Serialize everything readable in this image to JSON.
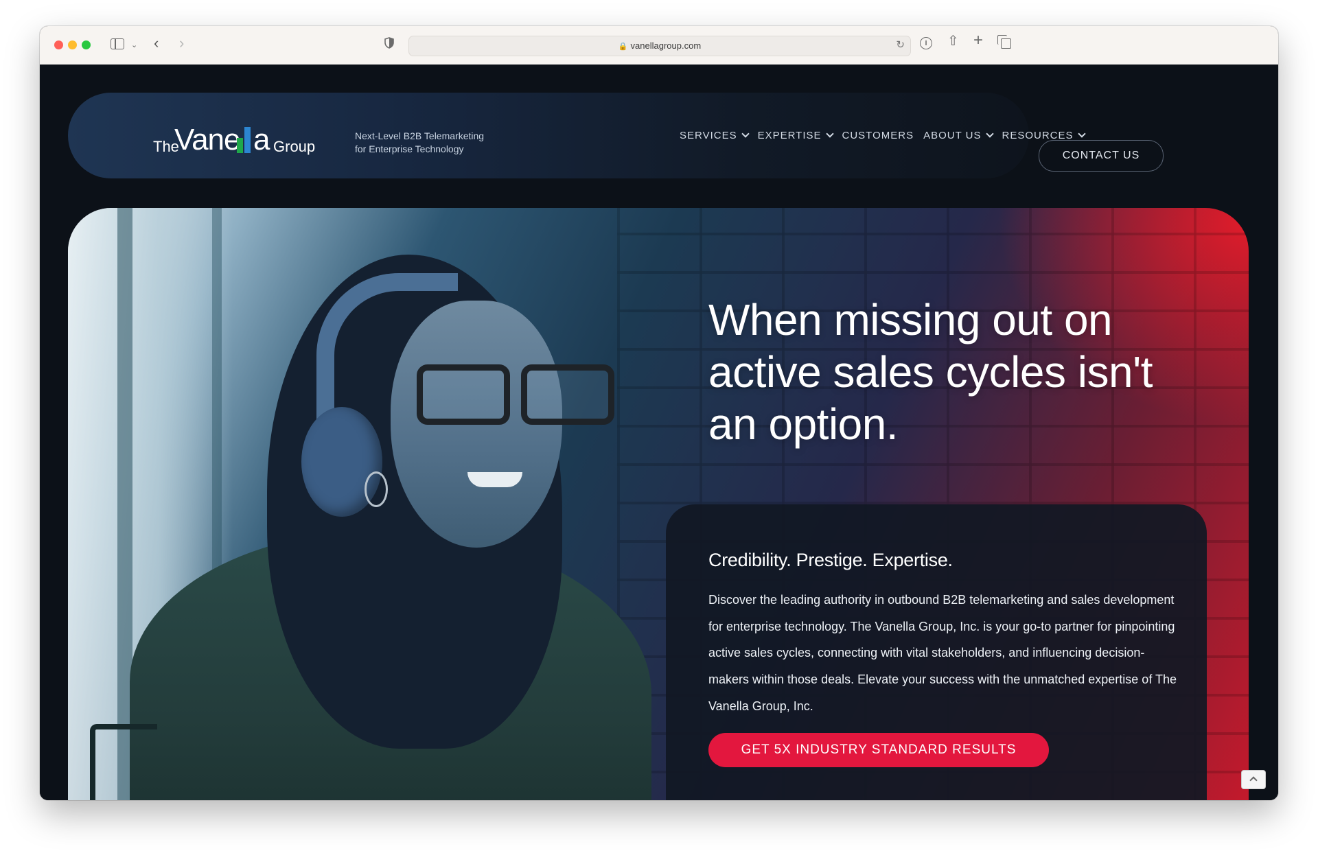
{
  "browser": {
    "url": "vanellagroup.com"
  },
  "logo": {
    "the": "The",
    "vane": "Vane",
    "a": "a",
    "group": "Group",
    "colors": {
      "green": "#1fa84a",
      "blue": "#2c86d1"
    }
  },
  "tagline": {
    "line1": "Next-Level B2B Telemarketing",
    "line2": "for Enterprise Technology"
  },
  "nav": {
    "items": [
      {
        "label": "SERVICES",
        "has_dropdown": true
      },
      {
        "label": "EXPERTISE",
        "has_dropdown": true
      },
      {
        "label": "CUSTOMERS",
        "has_dropdown": false
      },
      {
        "label": "ABOUT US",
        "has_dropdown": true
      },
      {
        "label": "RESOURCES",
        "has_dropdown": true
      }
    ],
    "contact_label": "CONTACT US"
  },
  "hero": {
    "headline_line1": "When missing out on",
    "headline_line2": "active sales cycles isn't",
    "headline_line3": "an option.",
    "card_title": "Credibility. Prestige. Expertise.",
    "card_body": "Discover the leading authority in outbound B2B telemarketing and sales development for enterprise technology. The Vanella Group, Inc. is your go-to partner for pinpointing active sales cycles, connecting with vital stakeholders, and influencing decision-makers within those deals. Elevate your success with the unmatched expertise of The Vanella Group, Inc.",
    "cta_label": "GET 5X INDUSTRY STANDARD RESULTS",
    "accent_color": "#e3173e"
  }
}
